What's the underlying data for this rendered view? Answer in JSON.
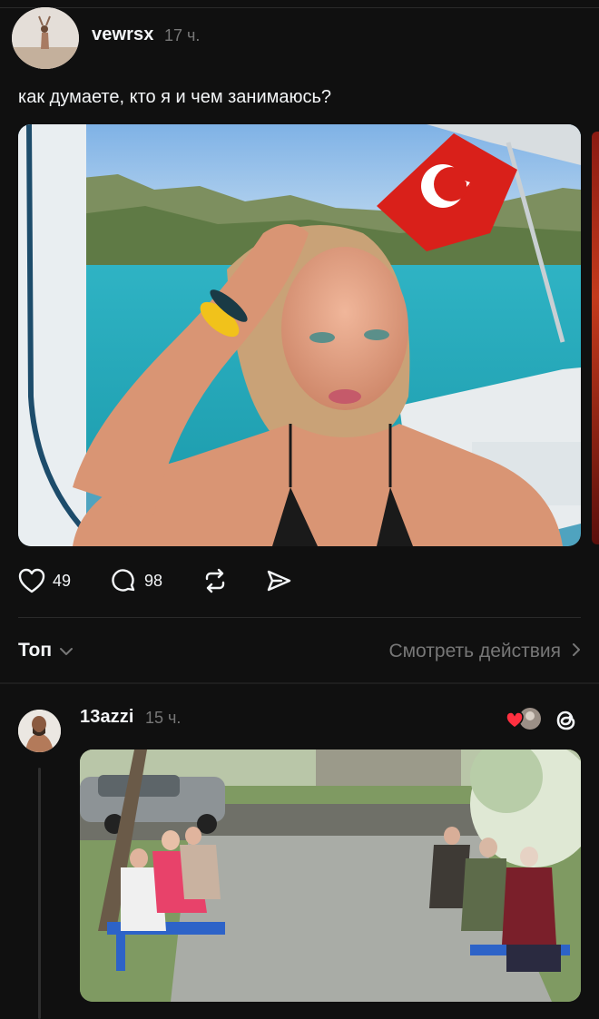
{
  "post1": {
    "username": "vewrsx",
    "time": "17 ч.",
    "text": "как думаете, кто я и чем занимаюсь?",
    "stats": {
      "likes": "49",
      "replies": "98"
    }
  },
  "comments_bar": {
    "sort_label": "Топ",
    "activity_label": "Смотреть действия"
  },
  "post2": {
    "username": "13azzi",
    "time": "15 ч."
  },
  "icons": [
    "heart-icon",
    "comment-icon",
    "repost-icon",
    "share-icon",
    "chevron-down-icon",
    "chevron-right-icon",
    "threads-logo-icon"
  ],
  "colors": {
    "background": "#101010",
    "text": "#f3f5f7",
    "secondary": "#777777",
    "like_red": "#ff3040"
  }
}
